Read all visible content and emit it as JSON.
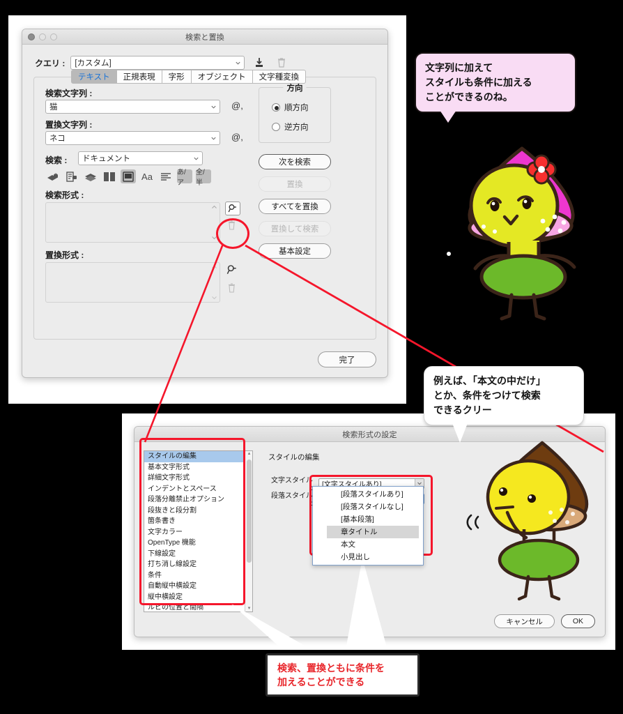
{
  "theme": {
    "background": "#000000",
    "page": "#ffffff",
    "dialog_bg": "#ececec",
    "accent_red": "#f5162b",
    "caption_red": "#e8252a",
    "bubble_pink": "#f9dcf4",
    "tab_active_text": "#1a73d6",
    "list_selection": "#a8c9ec"
  },
  "find_dialog": {
    "title": "検索と置換",
    "query_label": "クエリ :",
    "query_value": "[カスタム]",
    "save_query_icon": "save-query-icon",
    "delete_query_icon": "trash-icon",
    "tabs": [
      {
        "label": "テキスト",
        "active": true
      },
      {
        "label": "正規表現",
        "active": false
      },
      {
        "label": "字形",
        "active": false
      },
      {
        "label": "オブジェクト",
        "active": false
      },
      {
        "label": "文字種変換",
        "active": false
      }
    ],
    "search_string_label": "検索文字列 :",
    "search_string_value": "猫",
    "replace_string_label": "置換文字列 :",
    "replace_string_value": "ネコ",
    "special_char_icon": "@,",
    "scope_label": "検索 :",
    "scope_value": "ドキュメント",
    "option_icons": [
      {
        "name": "lock-layers-icon",
        "glyph": "◣",
        "selected": false
      },
      {
        "name": "lock-items-icon",
        "glyph": "▤",
        "selected": false
      },
      {
        "name": "hidden-layers-icon",
        "glyph": "◆",
        "selected": false
      },
      {
        "name": "master-pages-icon",
        "glyph": "▥",
        "selected": false
      },
      {
        "name": "footnotes-icon",
        "glyph": "▣",
        "selected": true
      },
      {
        "name": "case-sensitive-icon",
        "glyph": "Aa",
        "selected": false
      },
      {
        "name": "whole-word-icon",
        "glyph": "≣",
        "selected": false
      },
      {
        "name": "kana-icon",
        "glyph": "あ/ア",
        "selected": true
      },
      {
        "name": "width-icon",
        "glyph": "全/半",
        "selected": true
      }
    ],
    "find_format_label": "検索形式 :",
    "replace_format_label": "置換形式 :",
    "find_format_value": "",
    "replace_format_value": "",
    "specify_format_icon": "specify-attributes-icon",
    "clear_format_icon": "trash-icon",
    "direction": {
      "legend": "方向",
      "options": [
        {
          "label": "順方向",
          "selected": true
        },
        {
          "label": "逆方向",
          "selected": false
        }
      ]
    },
    "buttons": [
      {
        "label": "次を検索",
        "state": "default"
      },
      {
        "label": "置換",
        "state": "disabled"
      },
      {
        "label": "すべてを置換",
        "state": "normal"
      },
      {
        "label": "置換して検索",
        "state": "disabled"
      },
      {
        "label": "基本設定",
        "state": "normal"
      }
    ],
    "done_button": "完了"
  },
  "format_dialog": {
    "title": "検索形式の設定",
    "categories": [
      "スタイルの編集",
      "基本文字形式",
      "詳細文字形式",
      "インデントとスペース",
      "段落分離禁止オプション",
      "段抜きと段分割",
      "箇条書き",
      "文字カラー",
      "OpenType 機能",
      "下線設定",
      "打ち消し線設定",
      "条件",
      "自動縦中横設定",
      "縦中横設定",
      "ルビの位置と間隔"
    ],
    "selected_category": "スタイルの編集",
    "panel_title": "スタイルの編集",
    "fields": [
      {
        "label": "文字スタイル :",
        "value": "[文字スタイルあり]"
      },
      {
        "label": "段落スタイル :",
        "value": "[段落スタイルあり]"
      }
    ],
    "open_dropdown": {
      "items": [
        {
          "label": "[段落スタイルあり]",
          "highlighted": false
        },
        {
          "label": "[段落スタイルなし]",
          "highlighted": false
        },
        {
          "label": "[基本段落]",
          "highlighted": false
        },
        {
          "label": "章タイトル",
          "highlighted": true
        },
        {
          "label": "本文",
          "highlighted": false
        },
        {
          "label": "小見出し",
          "highlighted": false
        }
      ]
    },
    "cancel_button": "キャンセル",
    "ok_button": "OK"
  },
  "annotations": {
    "bubble_pink": "文字列に加えて\nスタイルも条件に加える\nことができるのね。",
    "bubble_pink_lines": [
      "文字列に加えて",
      "スタイルも条件に加える",
      "ことができるのね。"
    ],
    "bubble_white_lines": [
      "例えば、「本文の中だけ」",
      "とか、条件をつけて検索",
      "できるクリー"
    ],
    "caption_lines": [
      "検索、置換ともに条件を",
      "加えることができる"
    ]
  },
  "characters": [
    {
      "name": "pink-mushroom-character",
      "hat_color": "#ee37cf",
      "body_color": "#e4e824",
      "skirt_color": "#6cb92a",
      "flower_color": "#f72f2f"
    },
    {
      "name": "brown-chestnut-character",
      "hat_color": "#6e3c10",
      "body_color": "#f5e81f",
      "skirt_color": "#6cb92a",
      "belly_color": "#d9a979"
    }
  ]
}
